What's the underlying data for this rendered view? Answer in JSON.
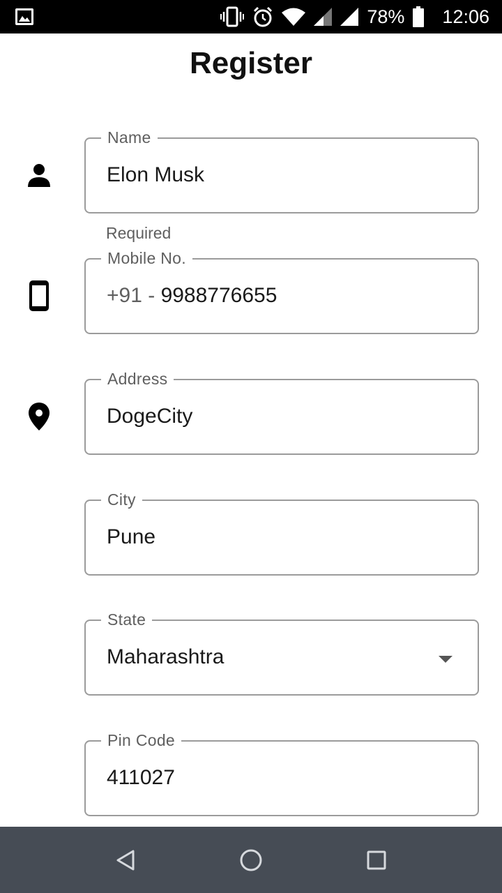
{
  "status_bar": {
    "battery": "78%",
    "time": "12:06",
    "icons": [
      "image-icon",
      "vibrate-icon",
      "alarm-icon",
      "wifi-icon",
      "signal-icon",
      "signal-icon",
      "battery-icon"
    ]
  },
  "header": {
    "title": "Register"
  },
  "form": {
    "name": {
      "label": "Name",
      "value": "Elon Musk",
      "helper": "Required",
      "icon": "person-icon"
    },
    "mobile": {
      "label": "Mobile No.",
      "prefix": "+91 - ",
      "value": "9988776655",
      "icon": "phone-icon"
    },
    "address": {
      "label": "Address",
      "value": "DogeCity",
      "icon": "location-pin-icon"
    },
    "city": {
      "label": "City",
      "value": "Pune"
    },
    "state": {
      "label": "State",
      "value": "Maharashtra",
      "icon": "dropdown-arrow-icon"
    },
    "pincode": {
      "label": "Pin Code",
      "value": "411027"
    }
  },
  "nav_bar": {
    "buttons": [
      "back-icon",
      "home-icon",
      "recents-icon"
    ]
  },
  "colors": {
    "status_bar": "#000000",
    "nav_bar": "#464c55",
    "field_border": "#9b9b9b",
    "label": "#5f5f5f"
  }
}
